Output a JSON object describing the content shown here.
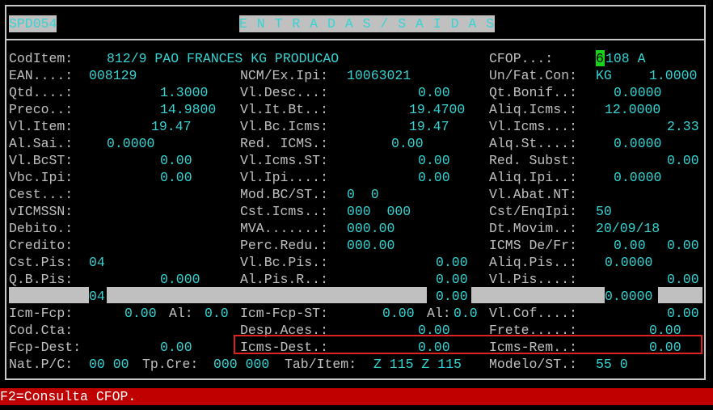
{
  "header": {
    "program_code": "SPD054",
    "screen_title": "E N T R A D A S / S A I D A S"
  },
  "fields": {
    "codItem_label": "CodItem:",
    "codItem_value": "812/9 PAO FRANCES KG PRODUCAO",
    "cfop_label": "CFOP...:",
    "cfop_cursor_char": "6",
    "cfop_value": "108 A",
    "ean_label": "EAN....:",
    "ean_value": "008129",
    "ncm_label": "NCM/Ex.Ipi:",
    "ncm_value": "10063021",
    "unfat_label": "Un/Fat.Con:",
    "unfat_unit": "KG",
    "unfat_factor": "1.0000",
    "qtd_label": "Qtd....:",
    "qtd_value": "1.3000",
    "vldesc_label": "Vl.Desc...:",
    "vldesc_value": "0.00",
    "qtbonif_label": "Qt.Bonif..:",
    "qtbonif_value": "0.0000",
    "preco_label": "Preco..:",
    "preco_value": "14.9800",
    "vlitbt_label": "Vl.It.Bt..:",
    "vlitbt_value": "19.4700",
    "aliqicms_label": "Aliq.Icms.:",
    "aliqicms_value": "12.0000",
    "vlitem_label": "Vl.Item:",
    "vlitem_value": "19.47",
    "vlbcicms_label": "Vl.Bc.Icms:",
    "vlbcicms_value": "19.47",
    "vlicms_label": "Vl.Icms...:",
    "vlicms_value": "2.33",
    "alsai_label": "Al.Sai.:",
    "alsai_value": "0.0000",
    "redicms_label": "Red. ICMS.:",
    "redicms_value": "0.00",
    "alqst_label": "Alq.St....:",
    "alqst_value": "0.0000",
    "vlbcst_label": "Vl.BcST:",
    "vlbcst_value": "0.00",
    "vlicmsst_label": "Vl.Icms.ST:",
    "vlicmsst_value": "0.00",
    "redsubst_label": "Red. Subst:",
    "redsubst_value": "0.00",
    "vbcipi_label": "Vbc.Ipi:",
    "vbcipi_value": "0.00",
    "vlipi_label": "Vl.Ipi....:",
    "vlipi_value": "0.00",
    "aliqipi_label": "Aliq.Ipi..:",
    "aliqipi_value": "0.0000",
    "cest_label": "Cest...:",
    "modbc_label": "Mod.BC/ST.:",
    "modbc_value": "0  0",
    "vlabat_label": "Vl.Abat.NT:",
    "vicmssn_label": "vICMSSN:",
    "csticms_label": "Cst.Icms..:",
    "csticms_value": "000  000",
    "cstenq_label": "Cst/EnqIpi:",
    "cstenq_value": "50",
    "debito_label": "Debito.:",
    "mva_label": "MVA.......:",
    "mva_value": "000.00",
    "dtmovim_label": "Dt.Movim..:",
    "dtmovim_value": "20/09/18",
    "credito_label": "Credito:",
    "percredu_label": "Perc.Redu.:",
    "percredu_value": "000.00",
    "icmsdefr_label": "ICMS De/Fr:",
    "icmsdefr_value1": "0.00",
    "icmsdefr_value2": "0.00",
    "cstpis_label": "Cst.Pis:",
    "cstpis_value": "04",
    "vlbcpis_label": "Vl.Bc.Pis.:",
    "vlbcpis_value": "0.00",
    "aliqpis_label": "Aliq.Pis..:",
    "aliqpis_value": "0.0000",
    "qbpis_label": "Q.B.Pis:",
    "qbpis_value": "0.000",
    "alpisr_label": "Al.Pis.R..:",
    "alpisr_value": "0.00",
    "vlpis_label": "Vl.Pis....:",
    "vlpis_value": "0.00",
    "cofins_cst_value": "04",
    "cofins_vl_value": "0.00",
    "cofins_aliq_value": "0.0000",
    "icmfcp_label": "Icm-Fcp:",
    "icmfcp_value": "0.00",
    "icmfcp_al_label": "Al:",
    "icmfcp_al_value": "0.0",
    "icmfcpst_label": "Icm-Fcp-ST:",
    "icmfcpst_value": "0.00",
    "icmfcpst_al_label": "Al:",
    "icmfcpst_al_value": "0.0",
    "vlcof_label": "Vl.Cof....:",
    "vlcof_value": "0.00",
    "codcta_label": "Cod.Cta:",
    "despaces_label": "Desp.Aces.:",
    "despaces_value": "0.00",
    "frete_label": "Frete.....:",
    "frete_value": "0.00",
    "fcpdest_label": "Fcp-Dest:",
    "fcpdest_value": "0.00",
    "icmsdest_label": "Icms-Dest.:",
    "icmsdest_value": "0.00",
    "icmsrem_label": "Icms-Rem..:",
    "icmsrem_value": "0.00",
    "natpc_label": "Nat.P/C:",
    "natpc_value": "00 00",
    "tpcre_label": "Tp.Cre:",
    "tpcre_value": "000 000",
    "tabitem_label": "Tab/Item:",
    "tabitem_value": "Z 115 Z 115",
    "modelost_label": "Modelo/ST.:",
    "modelost_value": "55 0"
  },
  "status_bar": {
    "text": "F2=Consulta CFOP."
  },
  "colors": {
    "background": "#000000",
    "label": "#c0c0c0",
    "value": "#36d3d3",
    "status_bar": "#c00000",
    "highlight_box": "#dd2222",
    "cursor": "#19d219"
  }
}
